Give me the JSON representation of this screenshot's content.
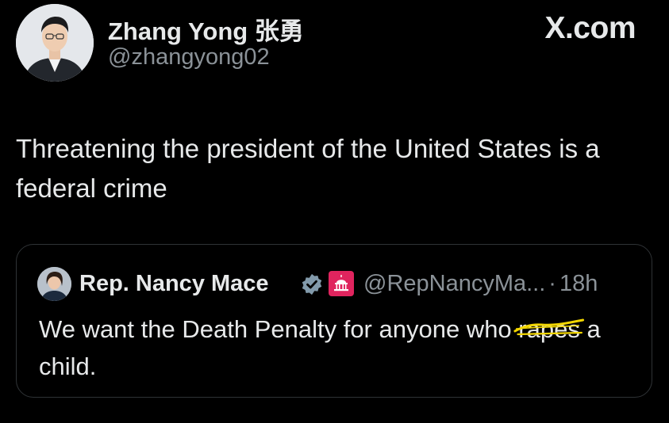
{
  "author": {
    "name": "Zhang Yong 张勇",
    "handle": "@zhangyong02"
  },
  "brand": {
    "label": "X.com"
  },
  "tweet": {
    "text": "Threatening the president of the United States is a federal crime"
  },
  "quoted": {
    "name": "Rep. Nancy Mace",
    "handle": "@RepNancyMa...",
    "separator": "·",
    "time": "18h",
    "text_before": "We want the Death Penalty for anyone who ",
    "text_struck": "rapes",
    "text_after": " a child."
  },
  "colors": {
    "background": "#000000",
    "text_primary": "#e7e9ea",
    "text_secondary": "#8b9298",
    "card_border": "#2f3336",
    "verified_badge": "#829aab",
    "gov_badge": "#e0245e",
    "scribble_highlight": "#f2d600"
  },
  "icons": {
    "verified": "verified-badge-icon",
    "government": "capitol-icon"
  }
}
